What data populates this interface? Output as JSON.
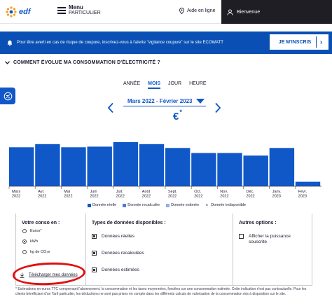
{
  "header": {
    "logo_text": "edf",
    "menu_line1": "Menu",
    "menu_line2": "PARTICULIER",
    "help_label": "Aide en ligne",
    "welcome_label": "Bienvenue"
  },
  "alert": {
    "text": "Pour être averti en cas de risque de coupure, inscrivez-vous à l'alerte \"vigilance coupure\" sur le site ECOWATT",
    "button_label": "JE M'INSCRIS"
  },
  "section": {
    "title": "COMMENT ÉVOLUE MA CONSOMMATION D'ÉLECTRICITÉ ?"
  },
  "periods": [
    "ANNÉE",
    "MOIS",
    "JOUR",
    "HEURE"
  ],
  "active_period": "MOIS",
  "range_label": "Mars 2022 - Février 2023",
  "unit_label": "€",
  "unit_mark": "*",
  "colors": {
    "brand_blue": "#1057c8",
    "bar_blue": "#1057c8",
    "recalc": "#4a7fd6",
    "estimated": "#8fb0e6",
    "alert_bg": "#0a4fb4"
  },
  "chart_data": {
    "type": "bar",
    "categories": [
      [
        "Mars",
        "2022"
      ],
      [
        "Avr.",
        "2022"
      ],
      [
        "Mai",
        "2022"
      ],
      [
        "Juin",
        "2022"
      ],
      [
        "Juil.",
        "2022"
      ],
      [
        "Août",
        "2022"
      ],
      [
        "Sept.",
        "2022"
      ],
      [
        "Oct.",
        "2022"
      ],
      [
        "Nov.",
        "2022"
      ],
      [
        "Déc.",
        "2022"
      ],
      [
        "Janv.",
        "2023"
      ],
      [
        "Févr.",
        "2023"
      ]
    ],
    "values": [
      61,
      66,
      61,
      62,
      69,
      66,
      60,
      52,
      52,
      48,
      60,
      7
    ],
    "ylim": [
      0,
      80
    ],
    "series_colors": [
      "#1057c8"
    ]
  },
  "legend": [
    {
      "label": "Donnée réelle",
      "color": "#1057c8"
    },
    {
      "label": "Donnée recalculée",
      "color": "#4a7fd6"
    },
    {
      "label": "Donnée estimée",
      "color": "#8fb0e6"
    },
    {
      "label": "Donnée indisponible",
      "color": "none"
    }
  ],
  "panel": {
    "conso_title": "Votre conso en :",
    "conso_options": [
      "Euros*",
      "kWh",
      "kg de CO₂e"
    ],
    "conso_selected": "kWh",
    "types_title": "Types de données disponibles :",
    "types": [
      "Données réelles",
      "Données recalculées",
      "Données estimées"
    ],
    "options_title": "Autres options :",
    "option_power": "Afficher la puissance souscrite",
    "download_label": "Télécharger mes données"
  },
  "footnote": {
    "line1": "* Estimations en euros TTC comprenant l'abonnement, la consommation et les taxes moyennées, fondées sur une consommation estimée. Cette indication n'est pas contractuelle. Pour les clients bénéficiant d'un Tarif particulier, les déductions ne sont pas prises en compte dans les différents calculs de valorisation de la consommation mis à disposition sur le site."
  }
}
